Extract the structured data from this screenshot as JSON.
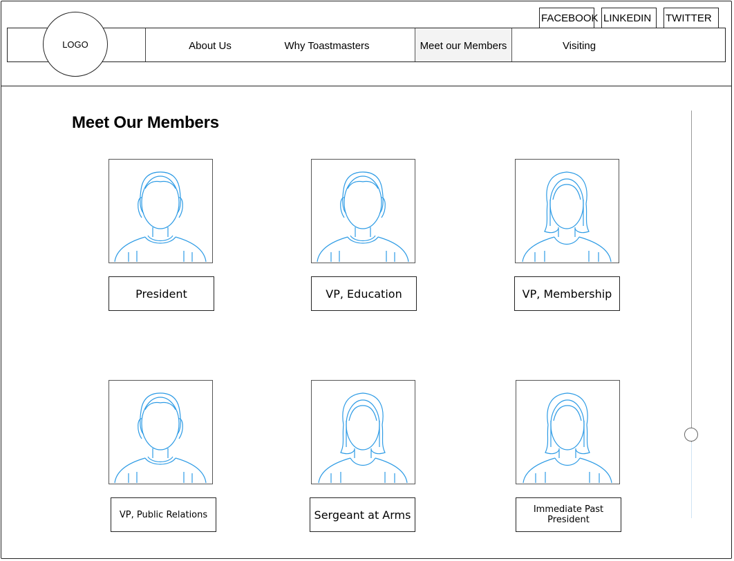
{
  "header": {
    "logo_text": "LOGO",
    "social": [
      "FACEBOOK",
      "LINKEDIN",
      "TWITTER"
    ],
    "nav": [
      "About Us",
      "Why Toastmasters",
      "Meet our Members",
      "Visiting"
    ],
    "active_nav": "Meet our Members"
  },
  "page": {
    "title": "Meet Our Members"
  },
  "members": [
    {
      "role": "President",
      "avatar": "male-avatar-icon"
    },
    {
      "role": "VP, Education",
      "avatar": "male-avatar-icon"
    },
    {
      "role": "VP, Membership",
      "avatar": "female-avatar-icon"
    },
    {
      "role": "VP, Public Relations",
      "avatar": "male-avatar-icon"
    },
    {
      "role": "Sergeant at Arms",
      "avatar": "female-avatar-icon"
    },
    {
      "role": "Immediate Past President",
      "avatar": "female-avatar-icon"
    }
  ],
  "colors": {
    "avatar_stroke": "#2d9be5",
    "active_nav_bg": "#f3f3f3",
    "border": "#222222"
  },
  "scroll": {
    "position": 0.78
  }
}
